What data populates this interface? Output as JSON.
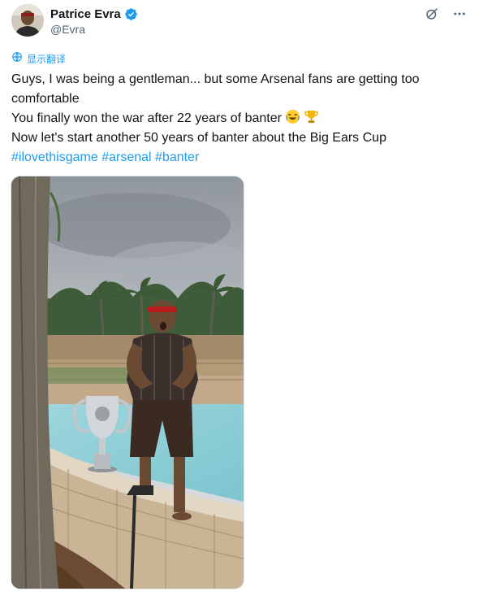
{
  "user": {
    "display_name": "Patrice Evra",
    "handle": "@Evra",
    "avatar_icon": "avatar-photo",
    "verified_icon": "verified-badge-icon",
    "verified_color": "#1d9bf0"
  },
  "actions": {
    "grok_icon": "grok-icon",
    "more_icon": "more-icon"
  },
  "translate": {
    "icon": "translate-icon",
    "label": "显示翻译"
  },
  "tweet": {
    "line1": "Guys, I was being a gentleman... but some Arsenal fans are getting too",
    "line2": "comfortable",
    "line3": "You finally won the war after 22 years of banter",
    "line3_emojis": [
      "laughing-face-emoji",
      "trophy-emoji"
    ],
    "line4": "Now let's start another 50 years of banter about the Big Ears Cup",
    "hashtags": [
      "#ilovethisgame",
      "#arsenal",
      "#banter"
    ]
  },
  "media": {
    "type": "video-still",
    "scene": "tweet-photo"
  },
  "colors": {
    "link": "#1d9bf0",
    "text": "#0f1419",
    "secondary": "#536471"
  }
}
